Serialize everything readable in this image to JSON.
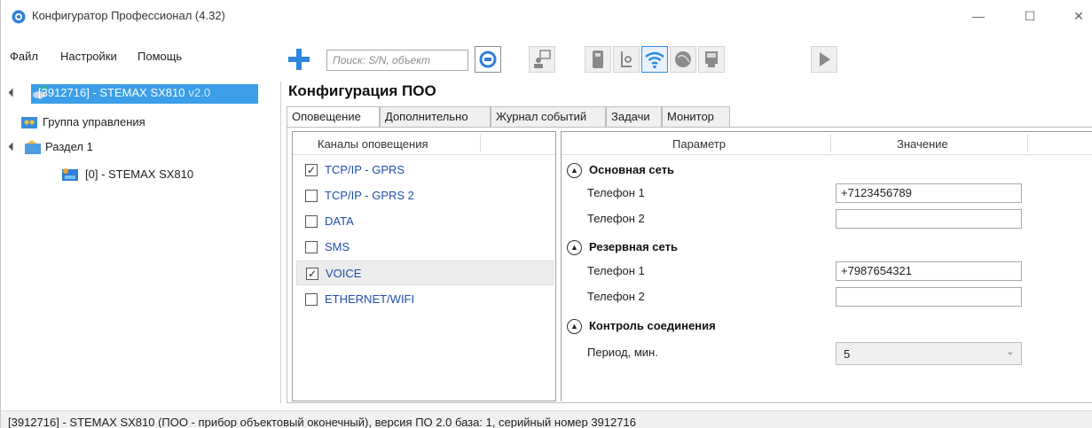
{
  "window": {
    "title": "Конфигуратор Профессионал (4.32)",
    "controls": {
      "minimize": "—",
      "maximize": "☐",
      "close": "✕"
    }
  },
  "menu": {
    "file": "Файл",
    "settings": "Настройки",
    "help": "Помощь"
  },
  "toolbar": {
    "search_placeholder": "Поиск: S/N, объект",
    "icons": [
      "add-icon",
      "search-device-icon",
      "user-icon",
      "usb-icon",
      "phone-icon",
      "wifi-icon",
      "globe-icon",
      "device-icon",
      "play-icon"
    ],
    "active": "wifi-icon",
    "accent_color": "#2b8be0"
  },
  "tree": {
    "device": {
      "label": "[3912716] - STEMAX SX810",
      "version": "v2.0"
    },
    "group": {
      "label": "Группа управления"
    },
    "section": {
      "label": "Раздел 1"
    },
    "object": {
      "label": "[0] - STEMAX SX810"
    },
    "selection_color": "#3a9ee8"
  },
  "main": {
    "title": "Конфигурация ПОО",
    "tabs": [
      {
        "label": "Оповещение",
        "active": true
      },
      {
        "label": "Дополнительно",
        "active": false
      },
      {
        "label": "Журнал событий",
        "active": false
      },
      {
        "label": "Задачи",
        "active": false
      },
      {
        "label": "Монитор",
        "active": false
      }
    ]
  },
  "channels": {
    "header": "Каналы оповещения",
    "items": [
      {
        "label": "TCP/IP - GPRS",
        "checked": true,
        "mark": "✓"
      },
      {
        "label": "TCP/IP - GPRS 2",
        "checked": false,
        "mark": ""
      },
      {
        "label": "DATA",
        "checked": false,
        "mark": ""
      },
      {
        "label": "SMS",
        "checked": false,
        "mark": ""
      },
      {
        "label": "VOICE",
        "checked": true,
        "mark": "✓"
      },
      {
        "label": "ETHERNET/WIFI",
        "checked": false,
        "mark": ""
      }
    ],
    "link_color": "#1f4fa8"
  },
  "params": {
    "header_param": "Параметр",
    "header_value": "Значение",
    "groups": [
      {
        "label": "Основная сеть",
        "rows": [
          {
            "label": "Телефон 1",
            "value": "+7123456789"
          },
          {
            "label": "Телефон 2",
            "value": ""
          }
        ]
      },
      {
        "label": "Резервная сеть",
        "rows": [
          {
            "label": "Телефон 1",
            "value": "+7987654321"
          },
          {
            "label": "Телефон 2",
            "value": ""
          }
        ]
      },
      {
        "label": "Контроль соединения",
        "rows": [
          {
            "label": "Период, мин.",
            "value": "5"
          }
        ]
      }
    ],
    "collapse_glyph": "▲"
  },
  "statusbar": {
    "text": "[3912716] - STEMAX SX810 (ПОО - прибор объектовый оконечный), версия ПО 2.0 база: 1, серийный номер 3912716"
  }
}
